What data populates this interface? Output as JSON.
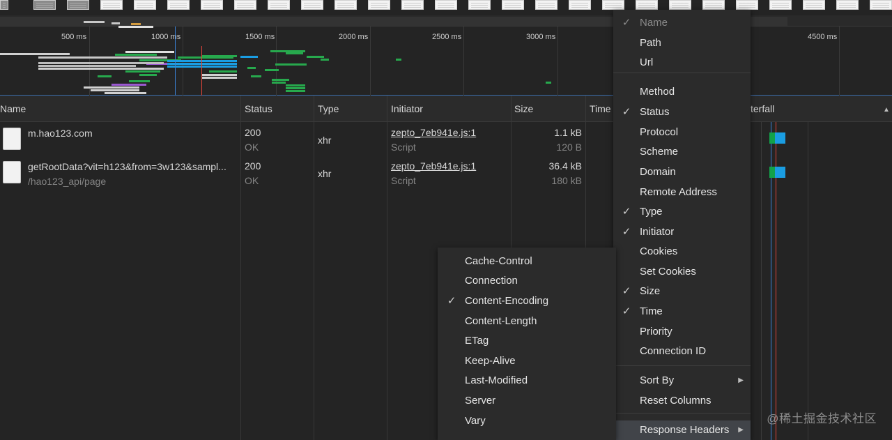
{
  "overview": {
    "ticks": [
      "500 ms",
      "1000 ms",
      "1500 ms",
      "2000 ms",
      "2500 ms",
      "3000 ms",
      "4500 ms"
    ]
  },
  "columns": {
    "name": "Name",
    "status": "Status",
    "type": "Type",
    "initiator": "Initiator",
    "size": "Size",
    "time": "Time",
    "waterfall": "terfall"
  },
  "rows": [
    {
      "name": "m.hao123.com",
      "path": "",
      "status": "200",
      "status_text": "OK",
      "type": "xhr",
      "initiator": "zepto_7eb941e.js:1",
      "initiator_type": "Script",
      "size": "1.1 kB",
      "resource_size": "120 B"
    },
    {
      "name": "getRootData?vit=h123&from=3w123&sampl...",
      "path": "/hao123_api/page",
      "status": "200",
      "status_text": "OK",
      "type": "xhr",
      "initiator": "zepto_7eb941e.js:1",
      "initiator_type": "Script",
      "size": "36.4 kB",
      "resource_size": "180 kB"
    }
  ],
  "column_menu": {
    "items": [
      {
        "label": "Name",
        "checked": true,
        "disabled": true
      },
      {
        "label": "Path",
        "checked": false
      },
      {
        "label": "Url",
        "checked": false
      },
      {
        "label": "Method",
        "checked": false
      },
      {
        "label": "Status",
        "checked": true
      },
      {
        "label": "Protocol",
        "checked": false
      },
      {
        "label": "Scheme",
        "checked": false
      },
      {
        "label": "Domain",
        "checked": false
      },
      {
        "label": "Remote Address",
        "checked": false
      },
      {
        "label": "Type",
        "checked": true
      },
      {
        "label": "Initiator",
        "checked": true
      },
      {
        "label": "Cookies",
        "checked": false
      },
      {
        "label": "Set Cookies",
        "checked": false
      },
      {
        "label": "Size",
        "checked": true
      },
      {
        "label": "Time",
        "checked": true
      },
      {
        "label": "Priority",
        "checked": false
      },
      {
        "label": "Connection ID",
        "checked": false
      },
      {
        "label": "Sort By",
        "checked": false,
        "submenu": true
      },
      {
        "label": "Reset Columns",
        "checked": false
      },
      {
        "label": "Response Headers",
        "checked": false,
        "submenu": true,
        "active": true
      }
    ]
  },
  "headers_menu": {
    "items": [
      {
        "label": "Cache-Control",
        "checked": false
      },
      {
        "label": "Connection",
        "checked": false
      },
      {
        "label": "Content-Encoding",
        "checked": true
      },
      {
        "label": "Content-Length",
        "checked": false
      },
      {
        "label": "ETag",
        "checked": false
      },
      {
        "label": "Keep-Alive",
        "checked": false
      },
      {
        "label": "Last-Modified",
        "checked": false
      },
      {
        "label": "Server",
        "checked": false
      },
      {
        "label": "Vary",
        "checked": false
      }
    ]
  },
  "icons": {
    "check": "✓",
    "submenu_arrow": "▶",
    "sort_arrow": "▲"
  },
  "watermark": "@稀土掘金技术社区"
}
